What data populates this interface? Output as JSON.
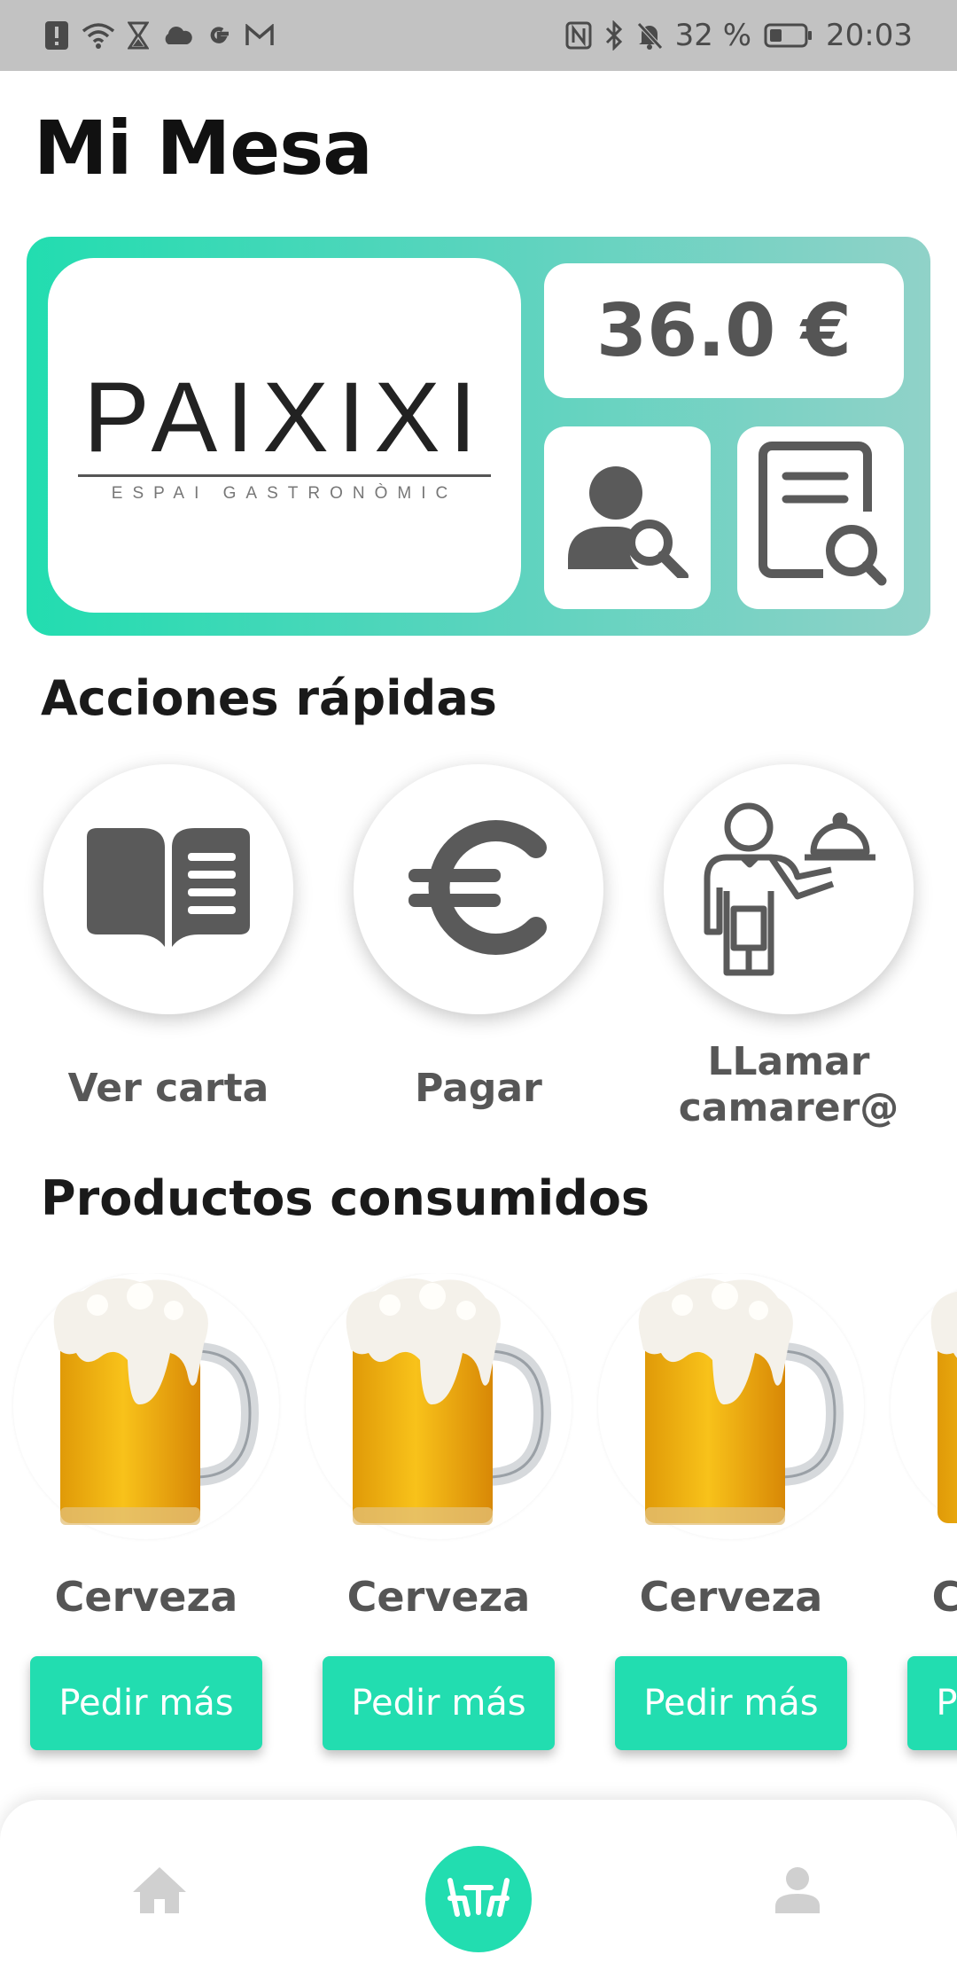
{
  "status_bar": {
    "battery": "32 %",
    "time": "20:03"
  },
  "header": {
    "title": "Mi Mesa"
  },
  "restaurant": {
    "logo_name": "PAIXIXI",
    "logo_tagline": "ESPAI GASTRONÒMIC",
    "total": "36.0 €",
    "icons": [
      "user-search-icon",
      "receipt-search-icon"
    ]
  },
  "quick_actions": {
    "title": "Acciones rápidas",
    "items": [
      {
        "label": "Ver carta",
        "icon": "menu-book-icon"
      },
      {
        "label": "Pagar",
        "icon": "euro-icon"
      },
      {
        "label": "LLamar camarer@",
        "line1": "LLamar",
        "line2": "camarer@",
        "icon": "waiter-icon"
      }
    ]
  },
  "products": {
    "title": "Productos consumidos",
    "items": [
      {
        "name": "Cerveza",
        "button": "Pedir más",
        "icon": "beer-mug-icon"
      },
      {
        "name": "Cerveza",
        "button": "Pedir más",
        "icon": "beer-mug-icon"
      },
      {
        "name": "Cerveza",
        "button": "Pedir más",
        "icon": "beer-mug-icon"
      },
      {
        "name": "Cerveza",
        "button": "Pedir más",
        "icon": "beer-mug-icon"
      }
    ]
  },
  "bottom_nav": {
    "items": [
      "home-icon",
      "table-icon",
      "profile-icon"
    ],
    "active": "table-icon"
  },
  "colors": {
    "accent": "#22ddb0",
    "icon_gray": "#5a5a5a",
    "status_bar": "#c2c2c2"
  }
}
